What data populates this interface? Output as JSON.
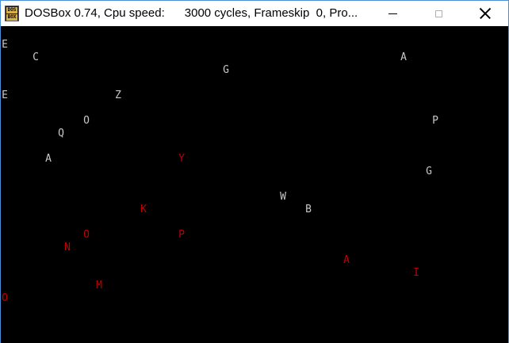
{
  "window": {
    "title": "DOSBox 0.74, Cpu speed:      3000 cycles, Frameskip  0, Pro...",
    "icon_name": "dosbox-app-icon",
    "icon_text_top": "DOS",
    "icon_text_bottom": "BOX",
    "controls": {
      "minimize_icon": "minimize-icon",
      "maximize_icon": "maximize-icon",
      "close_icon": "close-icon"
    }
  },
  "screen": {
    "background": "#000000",
    "colors": {
      "white": "#c8c8c8",
      "red": "#c00000"
    },
    "letters": [
      {
        "char": "E",
        "color": "white"
      },
      {
        "char": "C",
        "color": "white"
      },
      {
        "char": "G",
        "color": "white"
      },
      {
        "char": "A",
        "color": "white"
      },
      {
        "char": "E",
        "color": "white"
      },
      {
        "char": "Z",
        "color": "white"
      },
      {
        "char": "O",
        "color": "white"
      },
      {
        "char": "P",
        "color": "white"
      },
      {
        "char": "Q",
        "color": "white"
      },
      {
        "char": "A",
        "color": "white"
      },
      {
        "char": "Y",
        "color": "red"
      },
      {
        "char": "G",
        "color": "white"
      },
      {
        "char": "W",
        "color": "white"
      },
      {
        "char": "K",
        "color": "red"
      },
      {
        "char": "B",
        "color": "white"
      },
      {
        "char": "O",
        "color": "red"
      },
      {
        "char": "P",
        "color": "red"
      },
      {
        "char": "N",
        "color": "red"
      },
      {
        "char": "A",
        "color": "red"
      },
      {
        "char": "I",
        "color": "red"
      },
      {
        "char": "M",
        "color": "red"
      },
      {
        "char": "O",
        "color": "red"
      }
    ]
  }
}
